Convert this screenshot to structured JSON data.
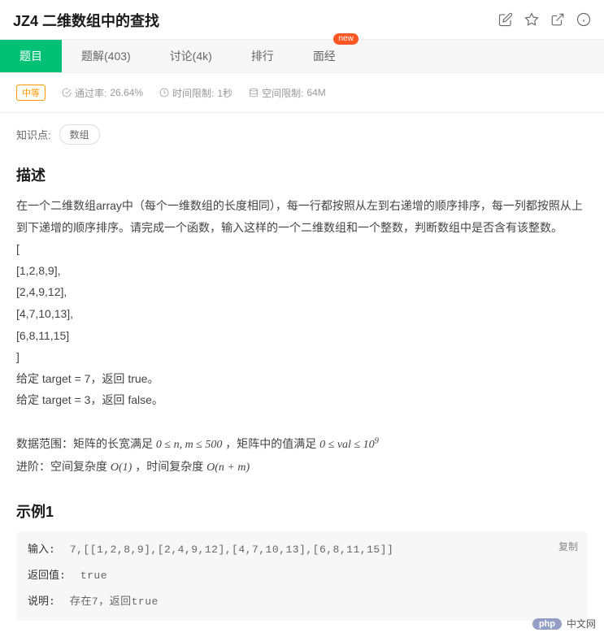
{
  "title": "JZ4 二维数组中的查找",
  "tabs": [
    {
      "label": "题目",
      "active": true
    },
    {
      "label": "题解(403)"
    },
    {
      "label": "讨论(4k)"
    },
    {
      "label": "排行"
    },
    {
      "label": "面经",
      "badge": "new"
    }
  ],
  "difficulty": "中等",
  "meta": {
    "pass_rate_label": "通过率:",
    "pass_rate_value": "26.64%",
    "time_limit_label": "时间限制:",
    "time_limit_value": "1秒",
    "space_limit_label": "空间限制:",
    "space_limit_value": "64M"
  },
  "knowledge_label": "知识点:",
  "knowledge_tags": [
    "数组"
  ],
  "description_title": "描述",
  "description_intro": "在一个二维数组array中（每个一维数组的长度相同），每一行都按照从左到右递增的顺序排序，每一列都按照从上到下递增的顺序排序。请完成一个函数，输入这样的一个二维数组和一个整数，判断数组中是否含有该整数。",
  "description_matrix": [
    "[",
    "[1,2,8,9],",
    "[2,4,9,12],",
    "[4,7,10,13],",
    "[6,8,11,15]",
    "]"
  ],
  "description_targets": [
    "给定 target = 7，返回 true。",
    "给定 target = 3，返回 false。"
  ],
  "data_range_html": "数据范围：矩阵的长宽满足 <span class='formula'>0 ≤ n, m ≤ 500</span> ，矩阵中的值满足 <span class='formula'>0 ≤ val ≤ 10<sup>9</sup></span>",
  "advanced_html": "进阶：空间复杂度 <span class='formula'>O(1)</span> ，时间复杂度 <span class='formula'>O(n + m)</span>",
  "example_title": "示例1",
  "example": {
    "input_label": "输入:",
    "input_value": "7,[[1,2,8,9],[2,4,9,12],[4,7,10,13],[6,8,11,15]]",
    "return_label": "返回值:",
    "return_value": "true",
    "explain_label": "说明:",
    "explain_value": "存在7，返回true",
    "copy_label": "复制"
  },
  "watermark": "中文网"
}
